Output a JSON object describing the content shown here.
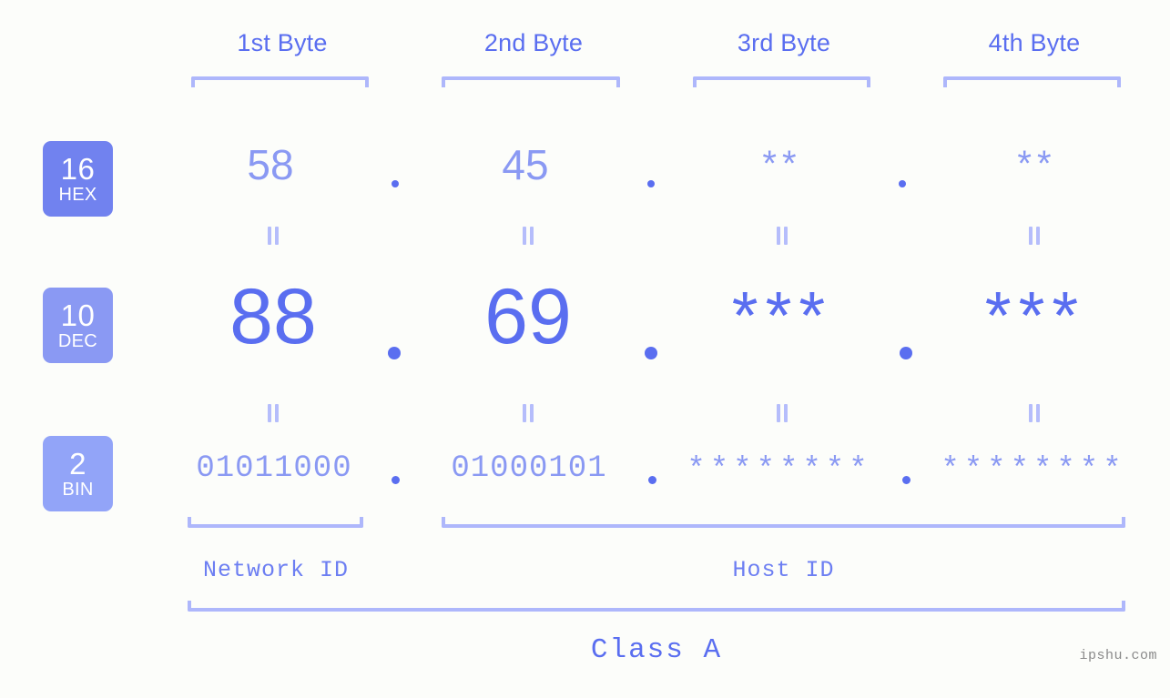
{
  "meta": {
    "watermark": "ipshu.com",
    "accent_dark": "#5a6ef0",
    "accent_mid": "#8a99f3",
    "accent_light": "#aeb7fb",
    "background": "#fcfdfa"
  },
  "columns": [
    {
      "label": "1st Byte"
    },
    {
      "label": "2nd Byte"
    },
    {
      "label": "3rd Byte"
    },
    {
      "label": "4th Byte"
    }
  ],
  "bases": [
    {
      "num": "16",
      "name": "HEX",
      "color": "#7182ef"
    },
    {
      "num": "10",
      "name": "DEC",
      "color": "#8a99f3"
    },
    {
      "num": "2",
      "name": "BIN",
      "color": "#92a4f8"
    }
  ],
  "rows": {
    "hex": {
      "base": "16",
      "name": "HEX",
      "values": [
        "58",
        "45",
        "**",
        "**"
      ]
    },
    "dec": {
      "base": "10",
      "name": "DEC",
      "values": [
        "88",
        "69",
        "***",
        "***"
      ]
    },
    "bin": {
      "base": "2",
      "name": "BIN",
      "values": [
        "01011000",
        "01000101",
        "********",
        "********"
      ]
    }
  },
  "separators": {
    "dot": ".",
    "equals": "||"
  },
  "footer": {
    "network_id": "Network ID",
    "host_id": "Host ID",
    "class": "Class A"
  }
}
